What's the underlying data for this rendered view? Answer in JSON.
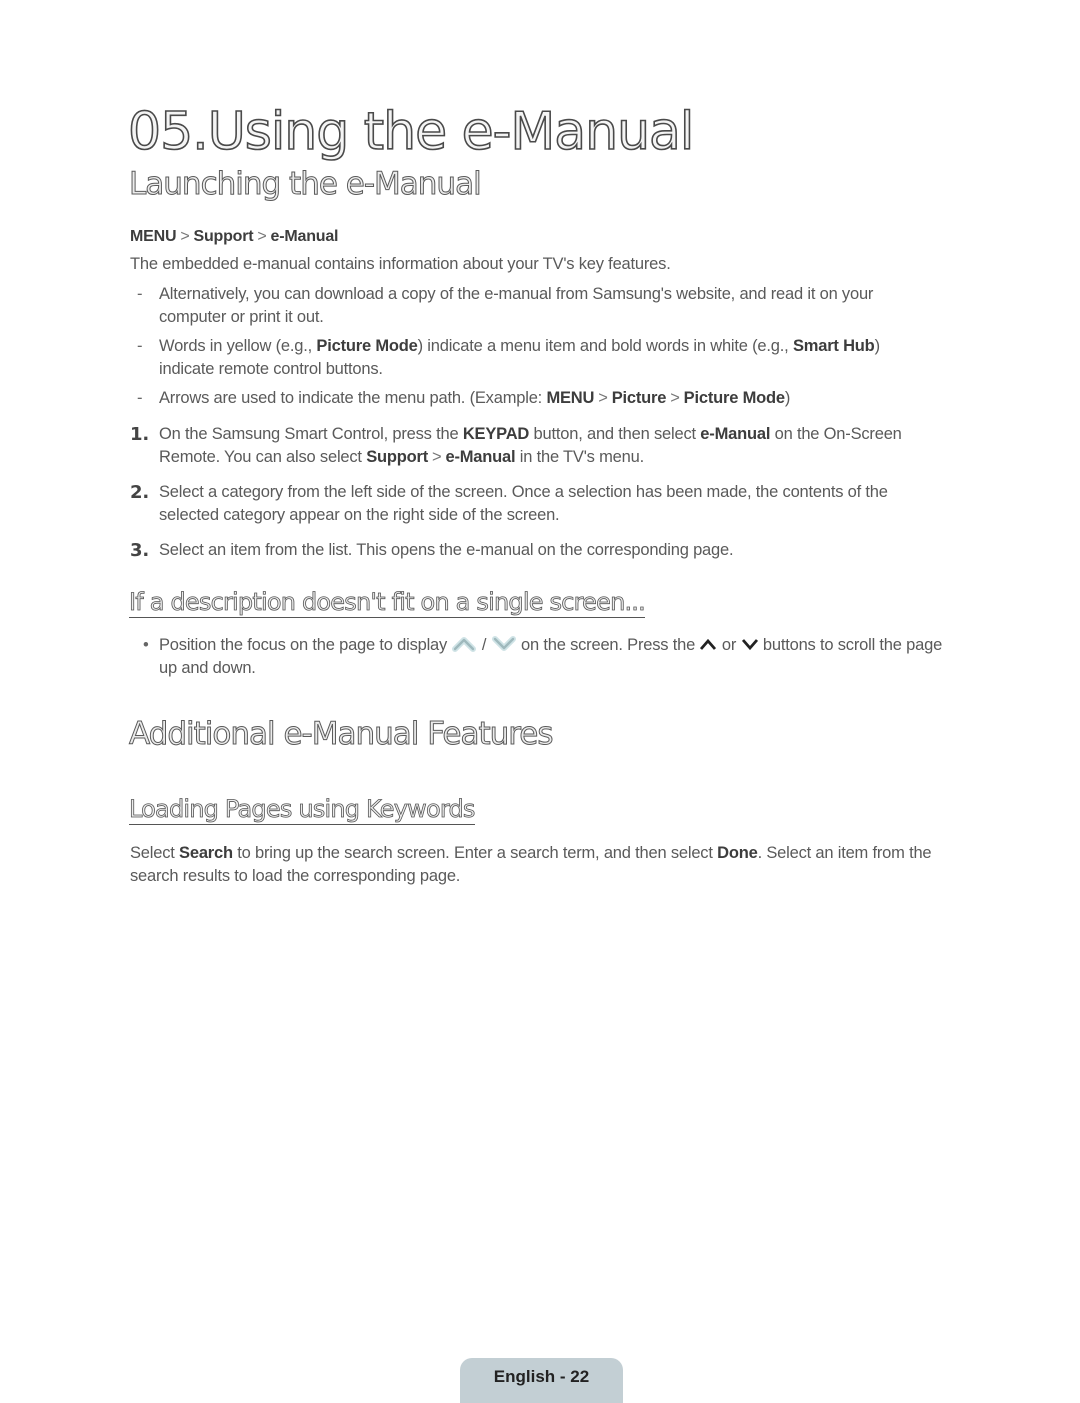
{
  "page": {
    "title": "05.Using the e-Manual",
    "sections": {
      "launching": {
        "heading": "Launching the e-Manual",
        "menu_path": [
          "MENU",
          "Support",
          "e-Manual"
        ],
        "intro": "The embedded e-manual contains information about your TV's key features.",
        "notes": [
          {
            "dash": "-",
            "text_1": "Alternatively, you can download a copy of the e-manual from Samsung's website, and read it on your computer or print it out."
          },
          {
            "dash": "-",
            "text_1": "Words in yellow (e.g., ",
            "bold_1": "Picture Mode",
            "text_2": ") indicate a menu item and bold words in white (e.g., ",
            "bold_2": "Smart Hub",
            "text_3": ") indicate remote control buttons."
          },
          {
            "dash": "-",
            "text_1": "Arrows are used to indicate the menu path. (Example: ",
            "path": [
              "MENU",
              "Picture",
              "Picture Mode"
            ],
            "text_2": ")"
          }
        ],
        "steps": [
          {
            "num": "1.",
            "text_1": "On the Samsung Smart Control, press the ",
            "bold_1": "KEYPAD",
            "text_2": " button, and then select ",
            "bold_2": "e-Manual",
            "text_3": " on the On-Screen Remote. You can also select ",
            "bold_3": "Support",
            "bold_4": "e-Manual",
            "text_4": " in the TV's menu."
          },
          {
            "num": "2.",
            "text_1": "Select a category from the left side of the screen. Once a selection has been made, the contents of the selected category appear on the right side of the screen."
          },
          {
            "num": "3.",
            "text_1": "Select an item from the list. This opens the e-manual on the corresponding page."
          }
        ]
      },
      "fit": {
        "heading": "If a description doesn't fit on a single screen...",
        "bullet": {
          "dot": "•",
          "text_1": "Position the focus on the page to display ",
          "icon_up_glow": "scroll-up-glow-icon",
          "slash": " / ",
          "icon_down_glow": "scroll-down-glow-icon",
          "text_2": " on the screen. Press the ",
          "icon_up": "caret-up-icon",
          "or": " or ",
          "icon_down": "caret-down-icon",
          "text_3": " buttons to scroll the page up and down."
        }
      },
      "additional": {
        "heading": "Additional e-Manual Features"
      },
      "keywords": {
        "heading": "Loading Pages using Keywords",
        "text_1": "Select ",
        "bold_1": "Search",
        "text_2": " to bring up the search screen. Enter a search term, and then select ",
        "bold_2": "Done",
        "text_3": ". Select an item from the search results to load the corresponding page."
      }
    },
    "footer": {
      "label": "English - 22"
    },
    "colors": {
      "footer_tab": "#c3cfd4",
      "text": "#5a5a5a",
      "heading_outline": "#4a4a4a"
    }
  }
}
